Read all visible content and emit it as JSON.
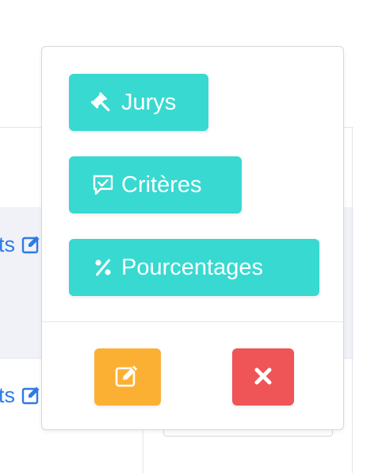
{
  "background": {
    "row1_link": {
      "text": "ts"
    },
    "row2_link": {
      "text": "ts"
    }
  },
  "popover": {
    "menu": [
      {
        "label": "Jurys",
        "icon": "gavel-icon"
      },
      {
        "label": "Critères",
        "icon": "comment-check-icon"
      },
      {
        "label": "Pourcentages",
        "icon": "percent-icon"
      }
    ],
    "actions": {
      "edit": {
        "icon": "edit-icon",
        "color": "#fbb034"
      },
      "delete": {
        "icon": "close-icon",
        "color": "#ef5456"
      }
    }
  },
  "colors": {
    "accent": "#38d9d1",
    "link": "#2d7be5",
    "warning": "#fbb034",
    "danger": "#ef5456"
  }
}
